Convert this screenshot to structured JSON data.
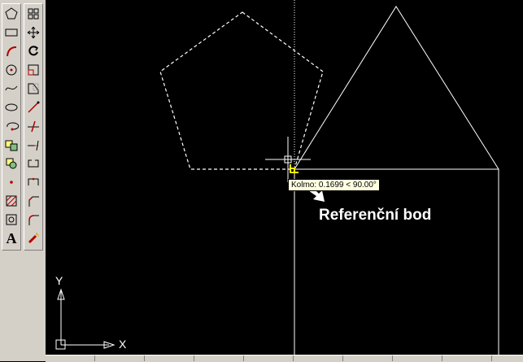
{
  "toolbar_draw": {
    "buttons": [
      {
        "icon": "polygon-icon",
        "label": "Polygon"
      },
      {
        "icon": "rectangle-icon",
        "label": "Rectangle"
      },
      {
        "icon": "arc-icon",
        "label": "Arc"
      },
      {
        "icon": "circle-icon",
        "label": "Circle"
      },
      {
        "icon": "spline-icon",
        "label": "Spline"
      },
      {
        "icon": "ellipse-icon",
        "label": "Ellipse"
      },
      {
        "icon": "ellipse-arc-icon",
        "label": "Ellipse Arc"
      },
      {
        "icon": "insert-block-icon",
        "label": "Insert Block"
      },
      {
        "icon": "make-block-icon",
        "label": "Make Block"
      },
      {
        "icon": "point-icon",
        "label": "Point"
      },
      {
        "icon": "hatch-icon",
        "label": "Hatch"
      },
      {
        "icon": "region-icon",
        "label": "Region"
      },
      {
        "icon": "multiline-text-icon",
        "label": "A"
      }
    ]
  },
  "toolbar_modify": {
    "buttons": [
      {
        "icon": "array-icon"
      },
      {
        "icon": "move-icon"
      },
      {
        "icon": "rotate-icon"
      },
      {
        "icon": "scale-icon"
      },
      {
        "icon": "stretch-icon"
      },
      {
        "icon": "lengthen-icon"
      },
      {
        "icon": "trim-icon"
      },
      {
        "icon": "extend-icon"
      },
      {
        "icon": "break-icon"
      },
      {
        "icon": "join-icon"
      },
      {
        "icon": "chamfer-icon"
      },
      {
        "icon": "fillet-icon"
      },
      {
        "icon": "explode-icon"
      }
    ]
  },
  "tooltip": {
    "text": "Kolmo: 0.1699 < 90.00°"
  },
  "annotation": {
    "text": "Referenční bod"
  },
  "ucs": {
    "y_label": "Y",
    "x_label": "X"
  },
  "colors": {
    "background": "#000000",
    "lines": "#ffffff",
    "toolbar": "#d4d0c8",
    "tooltip_bg": "#ffffe1",
    "osnap_marker": "#ffff00"
  }
}
